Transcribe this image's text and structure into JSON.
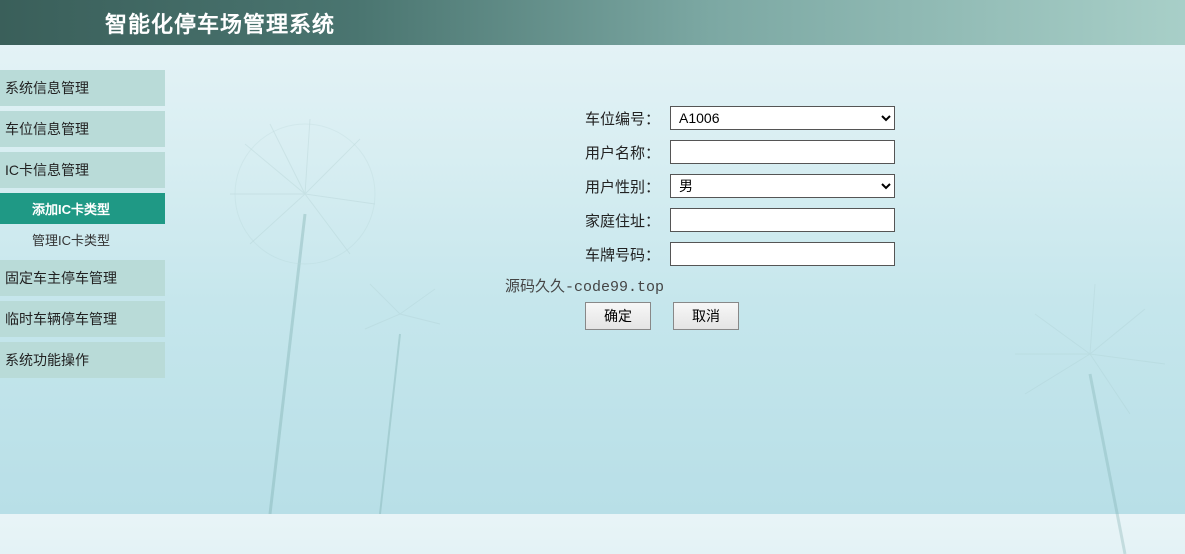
{
  "header": {
    "title": "智能化停车场管理系统"
  },
  "sidebar": {
    "items": [
      {
        "label": "系统信息管理",
        "sub": []
      },
      {
        "label": "车位信息管理",
        "sub": []
      },
      {
        "label": "IC卡信息管理",
        "sub": [
          {
            "label": "添加IC卡类型",
            "active": true
          },
          {
            "label": "管理IC卡类型",
            "active": false
          }
        ]
      },
      {
        "label": "固定车主停车管理",
        "sub": []
      },
      {
        "label": "临时车辆停车管理",
        "sub": []
      },
      {
        "label": "系统功能操作",
        "sub": []
      }
    ]
  },
  "form": {
    "parking_no": {
      "label": "车位编号：",
      "value": "A1006"
    },
    "username": {
      "label": "用户名称：",
      "value": ""
    },
    "gender": {
      "label": "用户性别：",
      "value": "男"
    },
    "address": {
      "label": "家庭住址：",
      "value": ""
    },
    "plate": {
      "label": "车牌号码：",
      "value": ""
    }
  },
  "watermark": "源码久久-code99.top",
  "buttons": {
    "ok": "确定",
    "cancel": "取消"
  }
}
